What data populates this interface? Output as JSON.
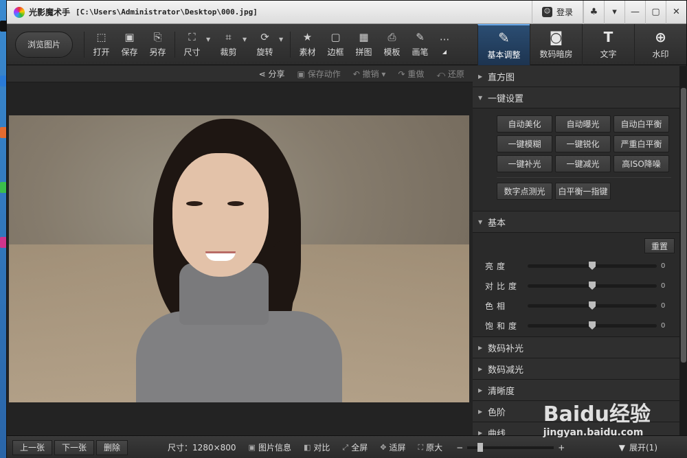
{
  "window": {
    "app_title": "光影魔术手",
    "file_path": "[C:\\Users\\Administrator\\Desktop\\000.jpg]",
    "login_label": "登录"
  },
  "toolbar": {
    "browse_label": "浏览图片",
    "tools": [
      "打开",
      "保存",
      "另存",
      "尺寸",
      "裁剪",
      "旋转",
      "素材",
      "边框",
      "拼图",
      "模板",
      "画笔"
    ],
    "more_label": "···",
    "right_tabs": [
      "基本调整",
      "数码暗房",
      "文字",
      "水印"
    ]
  },
  "subbar": {
    "share": "分享",
    "save_action": "保存动作",
    "undo": "撤销",
    "redo": "重做",
    "restore": "还原"
  },
  "panel": {
    "histogram": "直方图",
    "one_click": {
      "title": "一键设置",
      "buttons": [
        [
          "自动美化",
          "自动曝光",
          "自动白平衡"
        ],
        [
          "一键模糊",
          "一键锐化",
          "严重白平衡"
        ],
        [
          "一键补光",
          "一键减光",
          "高ISO降噪"
        ]
      ],
      "extra": [
        "数字点测光",
        "白平衡一指键"
      ]
    },
    "basic": {
      "title": "基本",
      "reset": "重置",
      "sliders": [
        {
          "label": "亮度",
          "value": "0",
          "level": 0.5
        },
        {
          "label": "对比度",
          "value": "0",
          "level": 0.5
        },
        {
          "label": "色相",
          "value": "0",
          "level": 0.5
        },
        {
          "label": "饱和度",
          "value": "0",
          "level": 0.5
        }
      ]
    },
    "sections": [
      "数码补光",
      "数码减光",
      "清晰度",
      "色阶",
      "曲线"
    ]
  },
  "bottom": {
    "prev": "上一张",
    "next": "下一张",
    "delete": "删除",
    "size": "尺寸：1280×800",
    "info": "图片信息",
    "compare": "对比",
    "fullscreen": "全屏",
    "fit": "适屏",
    "original": "原大",
    "zoom_level": 0.12,
    "expand": "展开(1)"
  },
  "watermark": {
    "brand": "Baidu经验",
    "url": "jingyan.baidu.com"
  }
}
